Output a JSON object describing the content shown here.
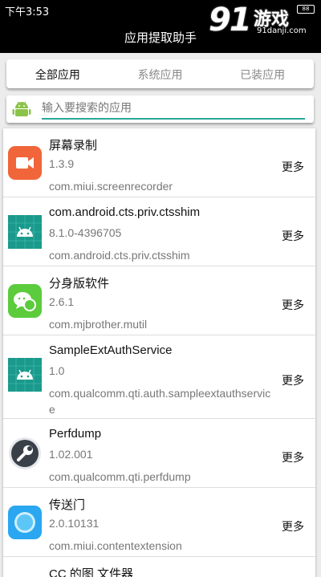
{
  "status_bar": {
    "time": "下午3:53",
    "battery": "88"
  },
  "watermark": {
    "logo": "91",
    "name": "游戏",
    "url": "91danji.com"
  },
  "title": "应用提取助手",
  "tabs": [
    {
      "label": "全部应用",
      "active": true
    },
    {
      "label": "系统应用",
      "active": false
    },
    {
      "label": "已装应用",
      "active": false
    }
  ],
  "search": {
    "placeholder": "输入要搜索的应用",
    "icon": "android-icon"
  },
  "more_label": "更多",
  "apps": [
    {
      "name": "屏幕录制",
      "version": "1.3.9",
      "package": "com.miui.screenrecorder",
      "icon": "screen-recorder-icon",
      "icon_color": "#f0653a"
    },
    {
      "name": "com.android.cts.priv.ctsshim",
      "version": "8.1.0-4396705",
      "package": "com.android.cts.priv.ctsshim",
      "icon": "android-icon",
      "icon_color": "#1a9a8c"
    },
    {
      "name": "分身版软件",
      "version": "2.6.1",
      "package": "com.mjbrother.mutil",
      "icon": "chat-icon",
      "icon_color": "#5ccb3c"
    },
    {
      "name": "SampleExtAuthService",
      "version": "1.0",
      "package": "com.qualcomm.qti.auth.sampleextauthservice",
      "icon": "android-icon",
      "icon_color": "#1a9a8c"
    },
    {
      "name": "Perfdump",
      "version": "1.02.001",
      "package": "com.qualcomm.qti.perfdump",
      "icon": "wrench-icon",
      "icon_color": "#3a4048"
    },
    {
      "name": "传送门",
      "version": "2.0.10131",
      "package": "com.miui.contentextension",
      "icon": "portal-icon",
      "icon_color": "#2aa7f0"
    },
    {
      "name": "CC 的图 文件器"
    }
  ]
}
